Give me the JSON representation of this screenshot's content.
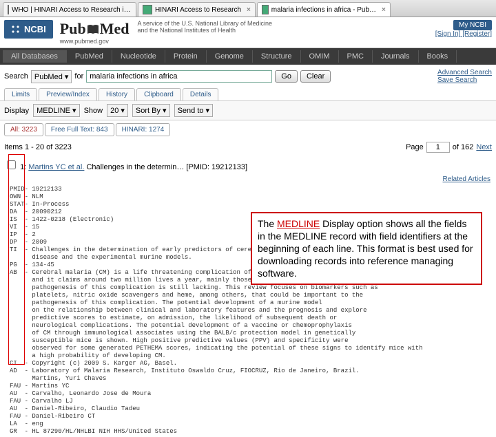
{
  "tabs": [
    {
      "label": "WHO | HINARI Access to Research i…"
    },
    {
      "label": "HINARI Access to Research"
    },
    {
      "label": "malaria infections in africa - Pub…",
      "active": true
    }
  ],
  "ncbi": {
    "label": "NCBI",
    "sub1": "A service of the U.S. National Library of Medicine",
    "sub2": "and the National Institutes of Health",
    "url": "www.pubmed.gov"
  },
  "pubmed": {
    "pub": "Pub",
    "med": "Med"
  },
  "myncbi": {
    "label": "My NCBI",
    "sign": "[Sign In] [Register]"
  },
  "nav": [
    "All Databases",
    "PubMed",
    "Nucleotide",
    "Protein",
    "Genome",
    "Structure",
    "OMIM",
    "PMC",
    "Journals",
    "Books"
  ],
  "search": {
    "label": "Search",
    "db": "PubMed",
    "for": "for",
    "q": "malaria infections in africa",
    "go": "Go",
    "clear": "Clear",
    "adv": "Advanced Search",
    "save": "Save Search"
  },
  "subtabs": [
    "Limits",
    "Preview/Index",
    "History",
    "Clipboard",
    "Details"
  ],
  "display": {
    "label": "Display",
    "fmt": "MEDLINE",
    "show": "Show",
    "n": "20",
    "sort": "Sort By",
    "send": "Send to"
  },
  "rtabs": [
    {
      "t": "All: 3223",
      "on": true
    },
    {
      "t": "Free Full Text: 843"
    },
    {
      "t": "HINARI: 1274"
    }
  ],
  "items": {
    "range": "Items 1 - 20 of 3223",
    "page_lbl": "Page",
    "page": "1",
    "of": "of 162",
    "next": "Next"
  },
  "rec": {
    "n": "1:",
    "au": "Martins YC et al.",
    "ti": "Challenges in the determin…",
    "pmid": "[PMID: 19212133]"
  },
  "rel": "Related Articles",
  "med": "PMID- 19212133\nOWN - NLM\nSTAT- In-Process\nDA  - 20090212\nIS  - 1422-0218 (Electronic)\nVI  - 15\nIP  - 2\nDP  - 2009\nTI  - Challenges in the determination of early predictors of cerebral malaria: lessons from the human\n      disease and the experimental murine models.\nPG  - 134-45\nAB  - Cerebral malaria (CM) is a life threatening complication of Plasmodium falciparum infection\n      and it claims around two million lives a year, mainly those of children. Despite years of study the\n      pathogenesis of this complication is still lacking. This review focuses on biomarkers such as\n      platelets, nitric oxide scavengers and heme, among others, that could be important to the\n      pathogenesis of this complication. The potential development of a murine model\n      on the relationship between clinical and laboratory features and the prognosis and explore\n      predictive scores to estimate, on admission, the likelihood of subsequent death or\n      neurological complications. The potential development of a vaccine or chemoprophylaxis\n      of CM through immunological associates using the BALB/c protection model in genetically\n      susceptible mice is shown. High positive predictive values (PPV) and specificity were\n      observed for some generated PETHEMA scores, indicating the potential of these signs to identify mice with\n      a high probability of developing CM.\nCI  - Copyright (c) 2009 S. Karger AG, Basel.\nAD  - Laboratory of Malaria Research, Instituto Oswaldo Cruz, FIOCRUZ, Rio de Janeiro, Brazil.\n      Martins, Yuri Chaves\nFAU - Martins YC\nAU  - Carvalho, Leonardo Jose de Moura\nFAU - Carvalho LJ\nAU  - Daniel-Ribeiro, Claudio Tadeu\nFAU - Daniel-Ribeiro CT\nLA  - eng\nGR  - HL 87290/HL/NHLBI NIH HHS/United States",
  "callout": {
    "p1a": "The ",
    "hl": "MEDLINE",
    "p1b": " Display option shows all the fields in the MEDLINE record with field identifiers at the beginning of each line. This format is best used for downloading records into reference managing software."
  }
}
